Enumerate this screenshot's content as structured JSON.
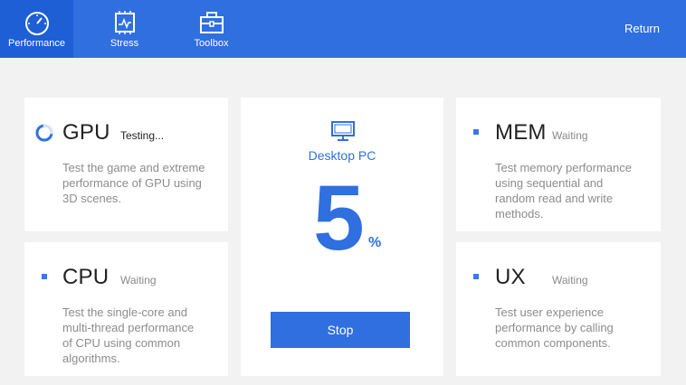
{
  "nav": {
    "items": [
      {
        "label": "Performance",
        "icon": "speedometer-icon",
        "active": true
      },
      {
        "label": "Stress",
        "icon": "cpu-chip-icon",
        "active": false
      },
      {
        "label": "Toolbox",
        "icon": "toolbox-icon",
        "active": false
      }
    ],
    "return_label": "Return"
  },
  "accent_color": "#2f6fe0",
  "tests": {
    "gpu": {
      "title": "GPU",
      "status": "Testing...",
      "description": [
        "Test the game and extreme",
        "performance of GPU using",
        "3D scenes."
      ]
    },
    "cpu": {
      "title": "CPU",
      "status": "Waiting",
      "description": [
        "Test the single-core and",
        "multi-thread performance",
        "of CPU using common",
        "algorithms."
      ]
    },
    "mem": {
      "title": "MEM",
      "status": "Waiting",
      "description": [
        "Test memory performance",
        "using sequential and",
        "random read and write",
        "methods."
      ]
    },
    "ux": {
      "title": "UX",
      "status": "Waiting",
      "description": [
        "Test user experience",
        "performance by calling",
        "common components."
      ]
    }
  },
  "progress": {
    "device": "Desktop PC",
    "value": "5",
    "unit": "%",
    "stop_label": "Stop"
  }
}
